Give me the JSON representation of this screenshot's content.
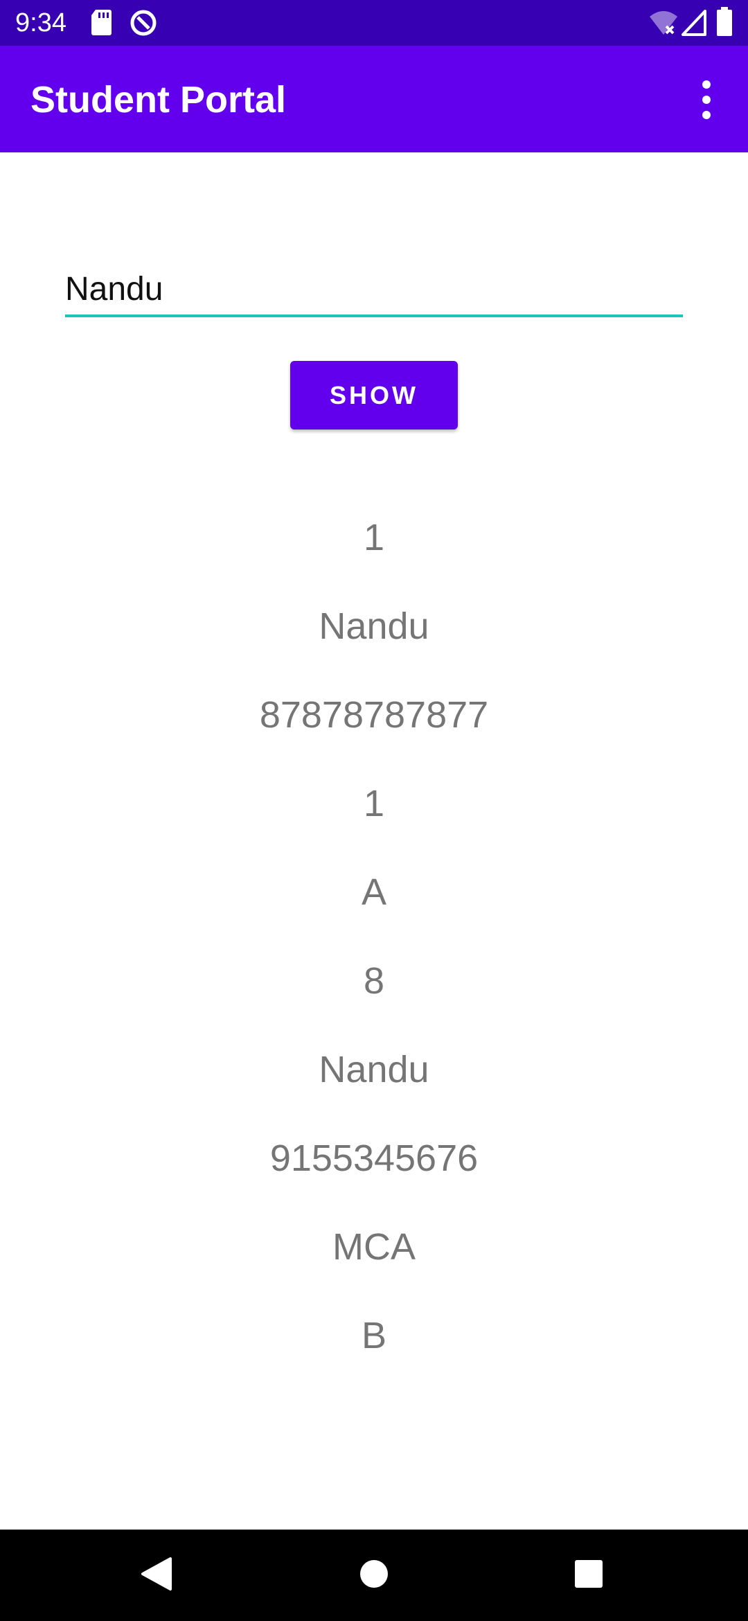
{
  "status_bar": {
    "time": "9:34",
    "icons": [
      "sd-card-icon",
      "data-saver-icon",
      "wifi-off-icon",
      "signal-icon",
      "battery-icon"
    ]
  },
  "app_bar": {
    "title": "Student Portal",
    "menu_icon": "more-vert-icon"
  },
  "search": {
    "value": "Nandu",
    "accent_color": "#1bc5bd"
  },
  "show_button": {
    "label": "SHOW"
  },
  "results": [
    "1",
    "Nandu",
    "87878787877",
    "1",
    "A",
    "8",
    "Nandu",
    "9155345676",
    "MCA",
    "B"
  ],
  "nav_bar": {
    "icons": [
      "back-icon",
      "home-icon",
      "recents-icon"
    ]
  },
  "colors": {
    "status_bar": "#3700b3",
    "primary": "#6200ee",
    "result_text": "#757575"
  }
}
